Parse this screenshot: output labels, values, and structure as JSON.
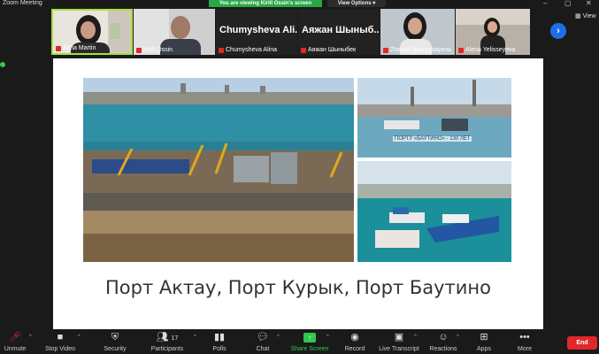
{
  "window": {
    "title": "Zoom Meeting"
  },
  "banner": {
    "text": "You are viewing Kirill Ossin's screen",
    "view_options": "View Options ▾"
  },
  "participants": [
    {
      "name": "Alma Martin"
    },
    {
      "name": "Kirill Ossin"
    },
    {
      "name": "Chumysheva Alina",
      "big": "Chumysheva Ali..."
    },
    {
      "name": "Аяжан Шыныбек",
      "big": "Аяжан Шыныб..."
    },
    {
      "name": "Zhanar Nauryzbayeva"
    },
    {
      "name": "Alena Yelisseyeva"
    }
  ],
  "view_label": "View",
  "slide": {
    "caption": "Порт Актау, Порт Курык, Порт Баутино",
    "sub_caption": "ПОРТУ «БАУТИНО» - 130 ЛЕТ"
  },
  "toolbar": {
    "unmute": "Unmute",
    "stop_video": "Stop Video",
    "security": "Security",
    "participants": "Participants",
    "participants_count": "17",
    "polls": "Polls",
    "chat": "Chat",
    "share_screen": "Share Screen",
    "record": "Record",
    "live_transcript": "Live Transcript",
    "reactions": "Reactions",
    "apps": "Apps",
    "more": "More",
    "end": "End"
  },
  "colors": {
    "accent_green": "#2ec94f",
    "end_red": "#e02828",
    "blue": "#1e6fe6"
  }
}
